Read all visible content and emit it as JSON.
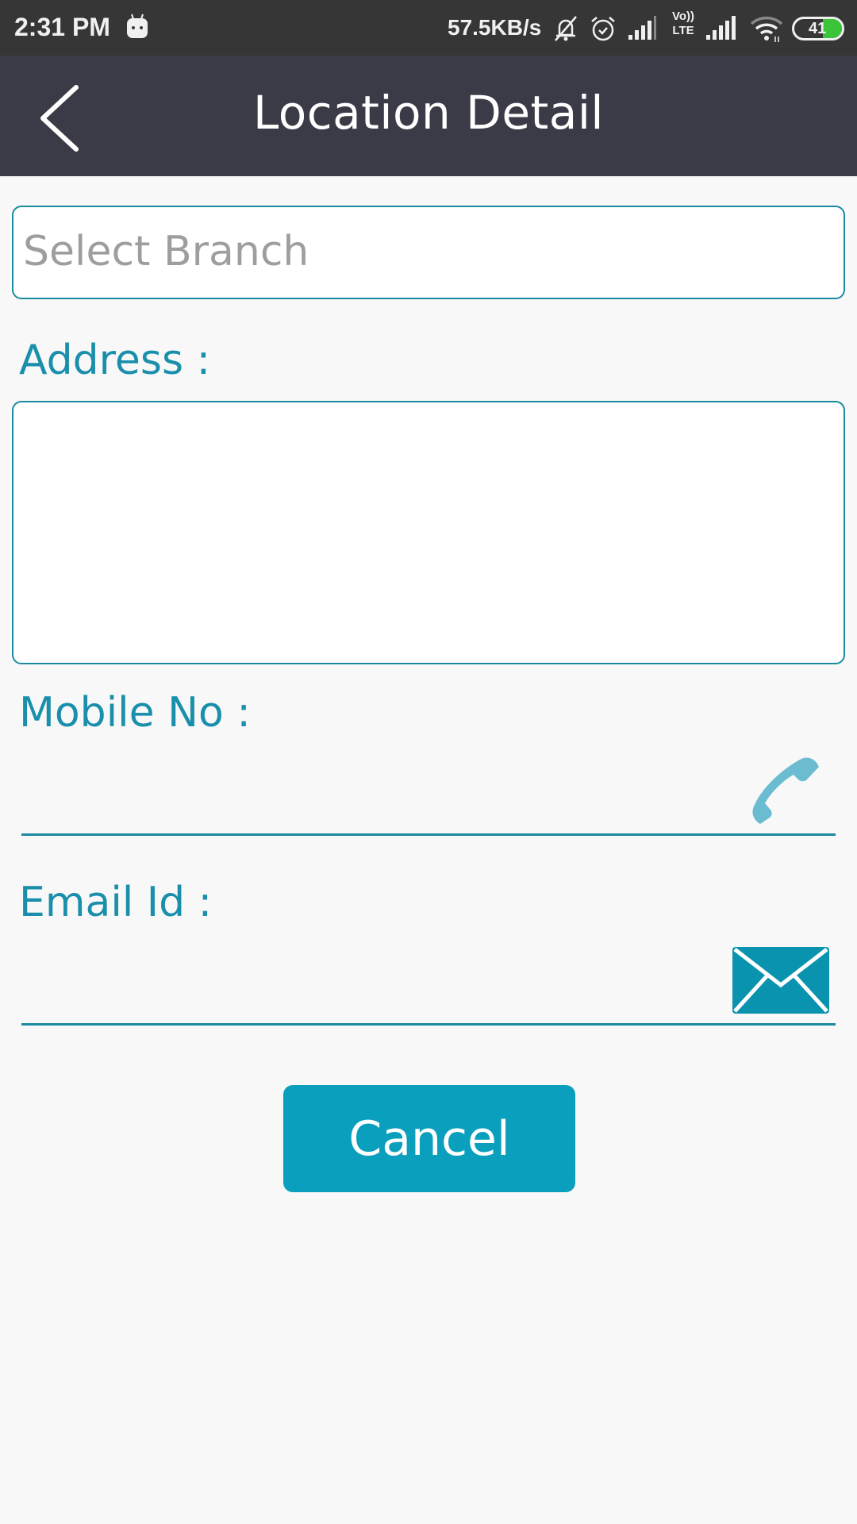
{
  "status_bar": {
    "time": "2:31 PM",
    "network_speed": "57.5KB/s",
    "battery_level": "41",
    "icons": [
      "android-debug-icon",
      "silent-bell-icon",
      "alarm-icon",
      "signal-icon",
      "volte-icon",
      "signal-icon",
      "wifi-icon",
      "battery-icon"
    ],
    "volte_label_top": "Vo))",
    "volte_label_bottom": "LTE"
  },
  "app_bar": {
    "title": "Location Detail",
    "back_icon": "chevron-left-icon"
  },
  "form": {
    "branch": {
      "placeholder": "Select Branch",
      "value": ""
    },
    "address": {
      "label": "Address :",
      "value": ""
    },
    "mobile": {
      "label": "Mobile No :",
      "value": "",
      "icon": "phone-icon"
    },
    "email": {
      "label": "Email Id :",
      "value": "",
      "icon": "mail-icon"
    }
  },
  "actions": {
    "cancel_label": "Cancel"
  },
  "colors": {
    "accent": "#1a8fab",
    "button": "#0aa0bd",
    "app_bar": "#3b3b47",
    "status_bar": "#363636",
    "phone_icon": "#6bbcd1",
    "mail_icon": "#0a93ae"
  }
}
